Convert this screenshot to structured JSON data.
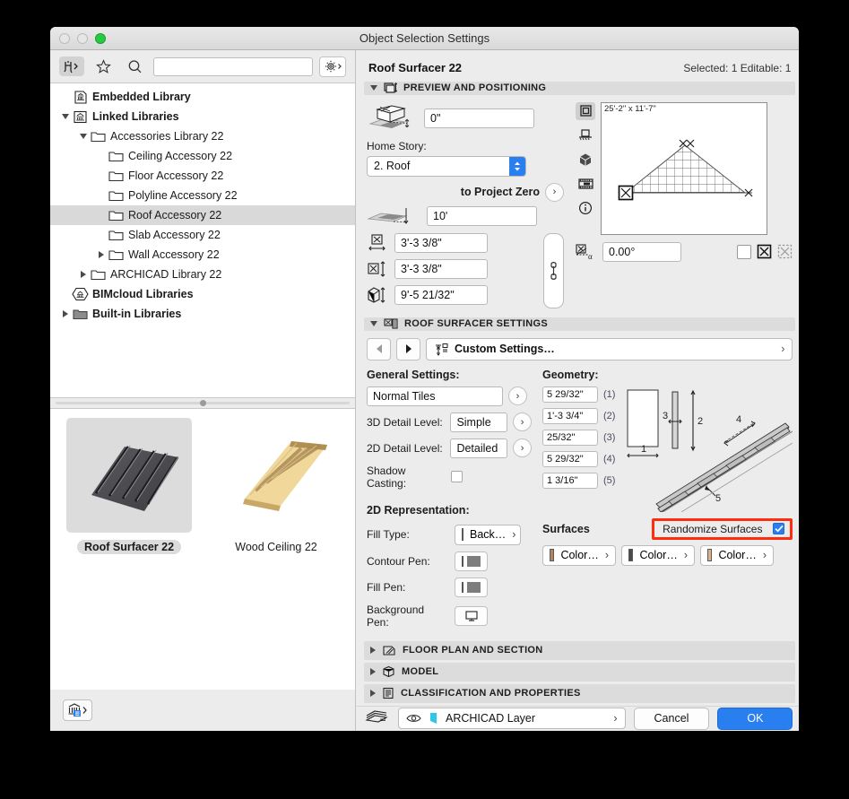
{
  "window": {
    "title": "Object Selection Settings",
    "traffic_lights": [
      "close-button",
      "minimize-button",
      "zoom-button"
    ]
  },
  "library_browser": {
    "toolbar": {
      "object_tool_icon": "chair-object-icon",
      "favorites_icon": "star-icon",
      "search_icon": "search-icon",
      "search_value": "",
      "search_placeholder": "",
      "settings_icon": "gear-icon"
    },
    "tree": [
      {
        "label": "Embedded Library",
        "depth": 0,
        "twisty": "none",
        "icon": "embedded-library-icon",
        "bold": true,
        "selected": false
      },
      {
        "label": "Linked Libraries",
        "depth": 0,
        "twisty": "down",
        "icon": "linked-library-icon",
        "bold": true,
        "selected": false
      },
      {
        "label": "Accessories Library 22",
        "depth": 1,
        "twisty": "down",
        "icon": "folder-icon",
        "bold": false,
        "selected": false
      },
      {
        "label": "Ceiling Accessory 22",
        "depth": 2,
        "twisty": "none",
        "icon": "folder-icon",
        "bold": false,
        "selected": false
      },
      {
        "label": "Floor Accessory 22",
        "depth": 2,
        "twisty": "none",
        "icon": "folder-icon",
        "bold": false,
        "selected": false
      },
      {
        "label": "Polyline Accessory 22",
        "depth": 2,
        "twisty": "none",
        "icon": "folder-icon",
        "bold": false,
        "selected": false
      },
      {
        "label": "Roof Accessory 22",
        "depth": 2,
        "twisty": "none",
        "icon": "folder-icon",
        "bold": false,
        "selected": true
      },
      {
        "label": "Slab Accessory 22",
        "depth": 2,
        "twisty": "none",
        "icon": "folder-icon",
        "bold": false,
        "selected": false
      },
      {
        "label": "Wall Accessory 22",
        "depth": 2,
        "twisty": "right",
        "icon": "folder-icon",
        "bold": false,
        "selected": false
      },
      {
        "label": "ARCHICAD Library 22",
        "depth": 1,
        "twisty": "right",
        "icon": "folder-icon",
        "bold": false,
        "selected": false
      },
      {
        "label": "BIMcloud Libraries",
        "depth": 0,
        "twisty": "none",
        "icon": "bimcloud-icon",
        "bold": true,
        "selected": false
      },
      {
        "label": "Built-in Libraries",
        "depth": 0,
        "twisty": "right",
        "icon": "folder-dark-icon",
        "bold": true,
        "selected": false
      }
    ],
    "thumbnails": [
      {
        "label": "Roof Surfacer 22",
        "icon": "roof-surfacer-preview",
        "selected": true
      },
      {
        "label": "Wood Ceiling 22",
        "icon": "wood-ceiling-preview",
        "selected": false
      }
    ],
    "footer_button": "library-manager-button"
  },
  "settings": {
    "object_name": "Roof Surfacer 22",
    "selection_status": "Selected: 1 Editable: 1",
    "sections": {
      "preview_positioning": {
        "title": "PREVIEW AND POSITIONING",
        "icon": "preview-positioning-icon",
        "expanded": true,
        "elevation_value": "0\"",
        "home_story_label": "Home Story:",
        "home_story_value": "2. Roof",
        "to_project_zero_label": "to Project Zero",
        "project_zero_value": "10'",
        "width_value": "3'-3 3/8\"",
        "depth_value": "3'-3 3/8\"",
        "height_value": "9'-5 21/32\"",
        "angle_value": "0.00°",
        "preview_dimensions": "25'-2\" x 11'-7\"",
        "view_modes": [
          "2d-symbol-view-icon",
          "elevation-view-icon",
          "3d-view-icon",
          "section-view-icon",
          "info-view-icon"
        ],
        "active_view_mode": 0
      },
      "roof_surfacer": {
        "title": "ROOF SURFACER SETTINGS",
        "icon": "roof-surfacer-icon",
        "expanded": true,
        "favorites_label": "Custom Settings…",
        "general_settings_label": "General Settings:",
        "tile_type_value": "Normal Tiles",
        "detail_3d_label": "3D Detail Level:",
        "detail_3d_value": "Simple",
        "detail_2d_label": "2D Detail Level:",
        "detail_2d_value": "Detailed",
        "shadow_casting_label": "Shadow Casting:",
        "shadow_casting_checked": false,
        "geometry_label": "Geometry:",
        "geometry_fields": [
          {
            "value": "5 29/32\"",
            "index": "(1)"
          },
          {
            "value": "1'-3 3/4\"",
            "index": "(2)"
          },
          {
            "value": "25/32\"",
            "index": "(3)"
          },
          {
            "value": "5 29/32\"",
            "index": "(4)"
          },
          {
            "value": "1 3/16\"",
            "index": "(5)"
          }
        ],
        "representation_2d_label": "2D Representation:",
        "fill_type_label": "Fill Type:",
        "fill_type_value": "Back…",
        "contour_pen_label": "Contour Pen:",
        "fill_pen_label": "Fill Pen:",
        "background_pen_label": "Background Pen:",
        "surfaces_label": "Surfaces",
        "randomize_surfaces_label": "Randomize Surfaces",
        "randomize_surfaces_checked": true,
        "randomize_highlight_color": "#ff2d0f",
        "surface_buttons": [
          {
            "label": "Color…",
            "color": "#b5825a"
          },
          {
            "label": "Color…",
            "color": "#4a4a4a"
          },
          {
            "label": "Color…",
            "color": "#dbb189"
          }
        ]
      },
      "floor_plan": {
        "title": "FLOOR PLAN AND SECTION",
        "icon": "floor-plan-icon",
        "expanded": false
      },
      "model": {
        "title": "MODEL",
        "icon": "model-cube-icon",
        "expanded": false
      },
      "classification": {
        "title": "CLASSIFICATION AND PROPERTIES",
        "icon": "classification-icon",
        "expanded": false
      }
    },
    "footer": {
      "layers_icon": "layers-icon",
      "eye_icon": "eye-icon",
      "layer_value": "ARCHICAD Layer",
      "cancel_label": "Cancel",
      "ok_label": "OK"
    }
  }
}
